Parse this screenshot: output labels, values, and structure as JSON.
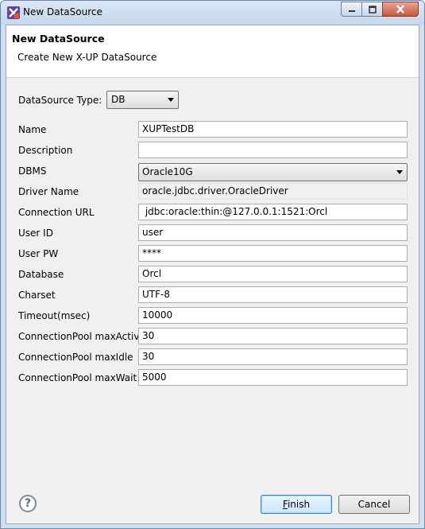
{
  "window": {
    "title": "New DataSource",
    "icon": "xup-app-icon"
  },
  "header": {
    "title": "New DataSource",
    "subtitle": "Create New X-UP DataSource"
  },
  "form": {
    "datasource_type": {
      "label": "DataSource Type:",
      "value": "DB"
    },
    "name": {
      "label": "Name",
      "value": "XUPTestDB"
    },
    "description": {
      "label": "Description",
      "value": ""
    },
    "dbms": {
      "label": "DBMS",
      "value": "Oracle10G"
    },
    "driver_name": {
      "label": "Driver Name",
      "value": "oracle.jdbc.driver.OracleDriver"
    },
    "connection_url": {
      "label": "Connection URL",
      "value": " jdbc:oracle:thin:@127.0.0.1:1521:Orcl"
    },
    "user_id": {
      "label": "User ID",
      "value": "user"
    },
    "user_pw": {
      "label": "User PW",
      "value": "****"
    },
    "database": {
      "label": "Database",
      "value": "Orcl"
    },
    "charset": {
      "label": "Charset",
      "value": "UTF-8"
    },
    "timeout": {
      "label": "Timeout(msec)",
      "value": "10000"
    },
    "pool_max_active": {
      "label": "ConnectionPool maxActive",
      "value": "30"
    },
    "pool_max_idle": {
      "label": "ConnectionPool maxIdle",
      "value": "30"
    },
    "pool_max_wait": {
      "label": "ConnectionPool maxWait",
      "value": "5000"
    }
  },
  "footer": {
    "help_icon": "help-icon",
    "finish_label": "Finish",
    "finish_mnemonic": "F",
    "finish_rest": "inish",
    "cancel_label": "Cancel"
  },
  "colors": {
    "titlebar": "#cfe0f1",
    "close_button": "#c55a40",
    "default_button_border": "#3c7fb1"
  }
}
